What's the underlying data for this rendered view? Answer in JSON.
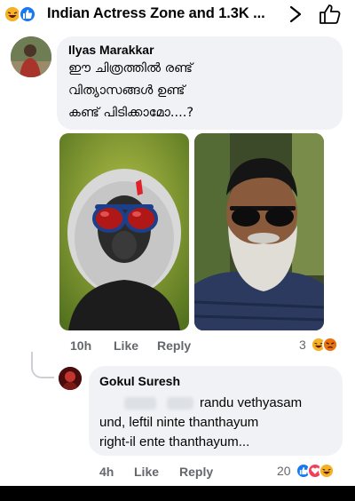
{
  "header": {
    "title": "Indian Actress Zone and 1.3K ...",
    "reaction_icons": [
      "haha-icon",
      "like-icon"
    ]
  },
  "comment": {
    "author": "Ilyas Marakkar",
    "text_lines": [
      "ഈ ചിത്രത്തിൽ രണ്ട്",
      "വിത്യാസങ്ങൾ ഉണ്ട്",
      "കണ്ട് പിടിക്കാമോ....?"
    ],
    "time": "10h",
    "like_label": "Like",
    "reply_label": "Reply",
    "reaction_count": "3",
    "reaction_icons": [
      "haha-icon",
      "angry-icon"
    ],
    "photos": [
      "monkey-sunglasses-photo",
      "bearded-man-sunglasses-photo"
    ]
  },
  "reply": {
    "author": "Gokul Suresh",
    "text_line1": "randu vethyasam",
    "text_line2": "und, leftil ninte thanthayum",
    "text_line3": "right-il ente thanthayum...",
    "time": "4h",
    "like_label": "Like",
    "reply_label": "Reply",
    "reaction_count": "20",
    "reaction_icons": [
      "like-icon",
      "love-icon",
      "haha-icon"
    ]
  },
  "colors": {
    "bubble": "#f0f2f5",
    "meta_text": "#65676b",
    "like_blue": "#1877f2",
    "love_red": "#f33e58",
    "haha_yellow": "#f7b125",
    "angry_orange": "#e9710f"
  }
}
